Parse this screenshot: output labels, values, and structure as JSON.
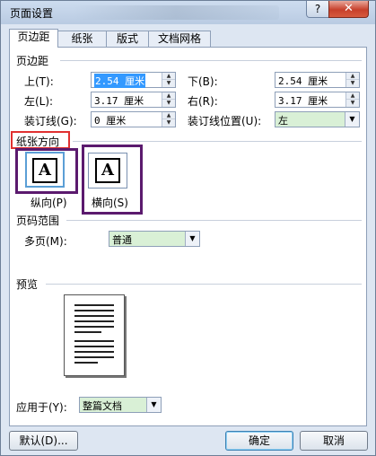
{
  "window": {
    "title": "页面设置",
    "help": "?",
    "close": "✕"
  },
  "tabs": [
    "页边距",
    "纸张",
    "版式",
    "文档网格"
  ],
  "margins": {
    "section": "页边距",
    "top_label": "上(T):",
    "top_value": "2.54 厘米",
    "bottom_label": "下(B):",
    "bottom_value": "2.54 厘米",
    "left_label": "左(L):",
    "left_value": "3.17 厘米",
    "right_label": "右(R):",
    "right_value": "3.17 厘米",
    "gutter_label": "装订线(G):",
    "gutter_value": "0 厘米",
    "gutter_pos_label": "装订线位置(U):",
    "gutter_pos_value": "左"
  },
  "orientation": {
    "section": "纸张方向",
    "portrait_label": "纵向(P)",
    "landscape_label": "横向(S)",
    "icon_letter": "A"
  },
  "pages": {
    "section": "页码范围",
    "multiple_label": "多页(M):",
    "multiple_value": "普通"
  },
  "preview": {
    "section": "预览"
  },
  "apply": {
    "label": "应用于(Y):",
    "value": "整篇文档"
  },
  "buttons": {
    "default": "默认(D)...",
    "ok": "确定",
    "cancel": "取消"
  },
  "colors": {
    "highlight_red": "#e03030",
    "highlight_purple": "#5b1a6e",
    "field_green": "#d9f0d6"
  }
}
